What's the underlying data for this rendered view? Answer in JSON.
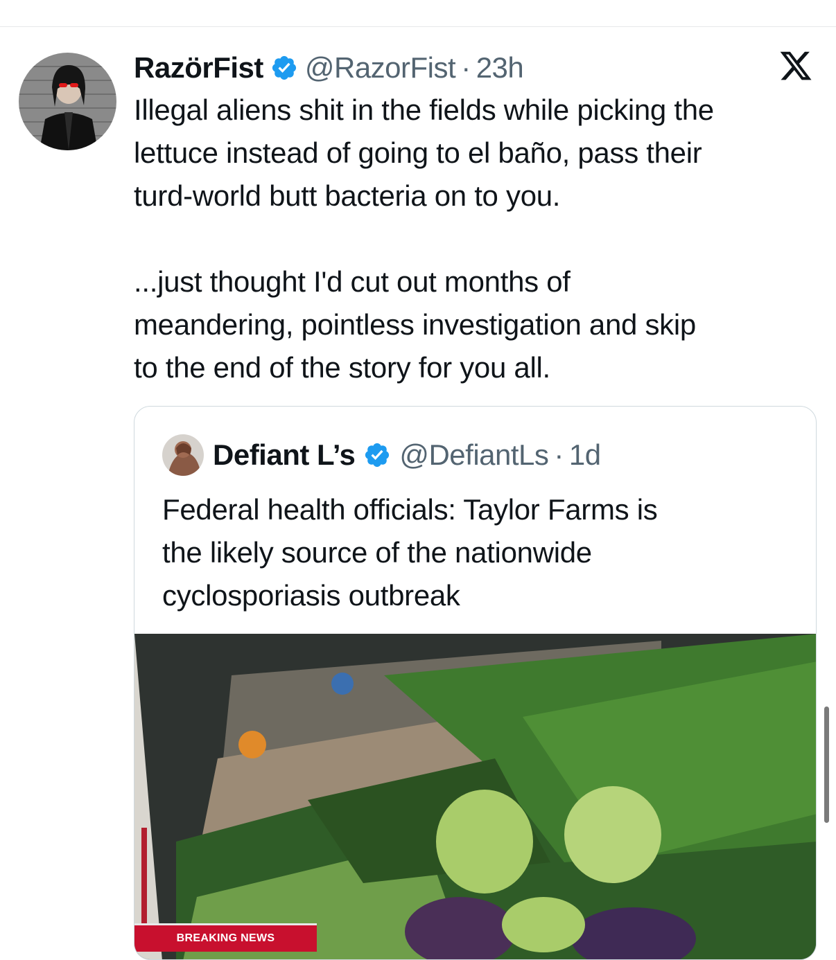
{
  "tweet": {
    "author_name": "RazörFist",
    "handle": "@RazorFist",
    "separator": "·",
    "time": "23h",
    "text": "Illegal aliens shit in the fields while picking the\nlettuce instead of going to el baño, pass their\nturd-world butt bacteria on to you.\n\n...just thought I'd cut out months of\nmeandering, pointless investigation and skip\nto the end of the story for you all.",
    "avatar_icon": "user-avatar-icon",
    "verified_icon": "verified-badge-icon",
    "platform_icon": "x-logo-icon"
  },
  "quote": {
    "author_name": "Defiant L’s",
    "handle": "@DefiantLs",
    "separator": "·",
    "time": "1d",
    "text": "Federal health officials: Taylor Farms is\nthe likely source of the nationwide\ncyclosporiasis outbreak",
    "media_banner": "BREAKING NEWS"
  },
  "colors": {
    "text": "#0f1419",
    "secondary_text": "#536471",
    "verified": "#1d9bf0",
    "border": "#cfd9de",
    "banner": "#c8102e"
  }
}
